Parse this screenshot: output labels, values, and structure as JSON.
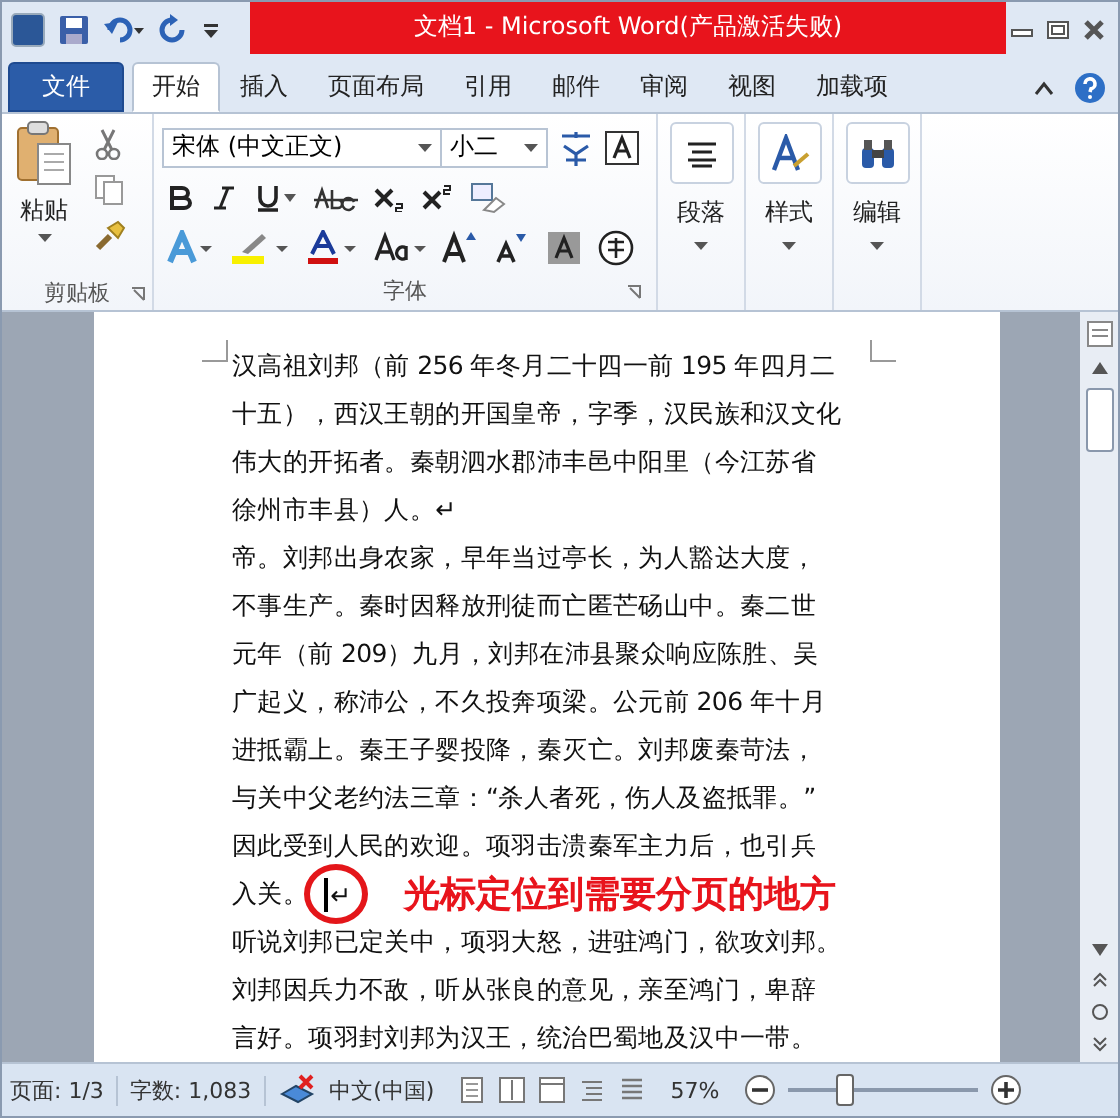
{
  "window": {
    "title": "文档1  -  Microsoft Word(产品激活失败)"
  },
  "file_tab": {
    "label": "文件"
  },
  "tabs": [
    {
      "label": "开始",
      "selected": true
    },
    {
      "label": "插入",
      "selected": false
    },
    {
      "label": "页面布局",
      "selected": false
    },
    {
      "label": "引用",
      "selected": false
    },
    {
      "label": "邮件",
      "selected": false
    },
    {
      "label": "审阅",
      "selected": false
    },
    {
      "label": "视图",
      "selected": false
    },
    {
      "label": "加载项",
      "selected": false
    }
  ],
  "ribbon": {
    "clipboard": {
      "paste_label": "粘贴",
      "group_label": "剪贴板"
    },
    "font": {
      "font_name": "宋体 (中文正文)",
      "font_size": "小二",
      "group_label": "字体"
    },
    "paragraph": {
      "label": "段落"
    },
    "styles": {
      "label": "样式"
    },
    "editing": {
      "label": "编辑"
    }
  },
  "document": {
    "lines": [
      {
        "text": "汉高祖刘邦（前 256 年冬月二十四一前 195 年四月二",
        "cursor": false
      },
      {
        "text": "十五），西汉王朝的开国皇帝，字季，汉民族和汉文化",
        "cursor": false
      },
      {
        "text": "伟大的开拓者。秦朝泗水郡沛丰邑中阳里（今江苏省",
        "cursor": false
      },
      {
        "text": "徐州市丰县）人。↵",
        "cursor": false
      },
      {
        "text": "帝。刘邦出身农家，早年当过亭长，为人豁达大度，",
        "cursor": false
      },
      {
        "text": "不事生产。秦时因释放刑徒而亡匿芒砀山中。秦二世",
        "cursor": false
      },
      {
        "text": "元年（前 209）九月，刘邦在沛县聚众响应陈胜、吴",
        "cursor": false
      },
      {
        "text": "广起义，称沛公，不久投奔项梁。公元前 206 年十月",
        "cursor": false
      },
      {
        "text": "进抵霸上。秦王子婴投降，秦灭亡。刘邦废秦苛法，",
        "cursor": false
      },
      {
        "text": "与关中父老约法三章：“杀人者死，伤人及盗抵罪。”",
        "cursor": false
      },
      {
        "text": "因此受到人民的欢迎。项羽击溃秦军主力后，也引兵",
        "cursor": false
      },
      {
        "text": "入关。",
        "cursor": true,
        "after_cursor": "↵"
      },
      {
        "text": "听说刘邦已定关中，项羽大怒，进驻鸿门，欲攻刘邦。",
        "cursor": false
      },
      {
        "text": "刘邦因兵力不敌，听从张良的意见，亲至鸿门，卑辞",
        "cursor": false
      },
      {
        "text": "言好。项羽封刘邦为汉王，统治巴蜀地及汉中一带。",
        "cursor": false
      }
    ],
    "annotation": "光标定位到需要分页的地方"
  },
  "status_bar": {
    "page": "页面: 1/3",
    "words": "字数: 1,083",
    "language": "中文(中国)",
    "zoom": "57%",
    "zoom_level": {
      "level": 0.3
    }
  }
}
